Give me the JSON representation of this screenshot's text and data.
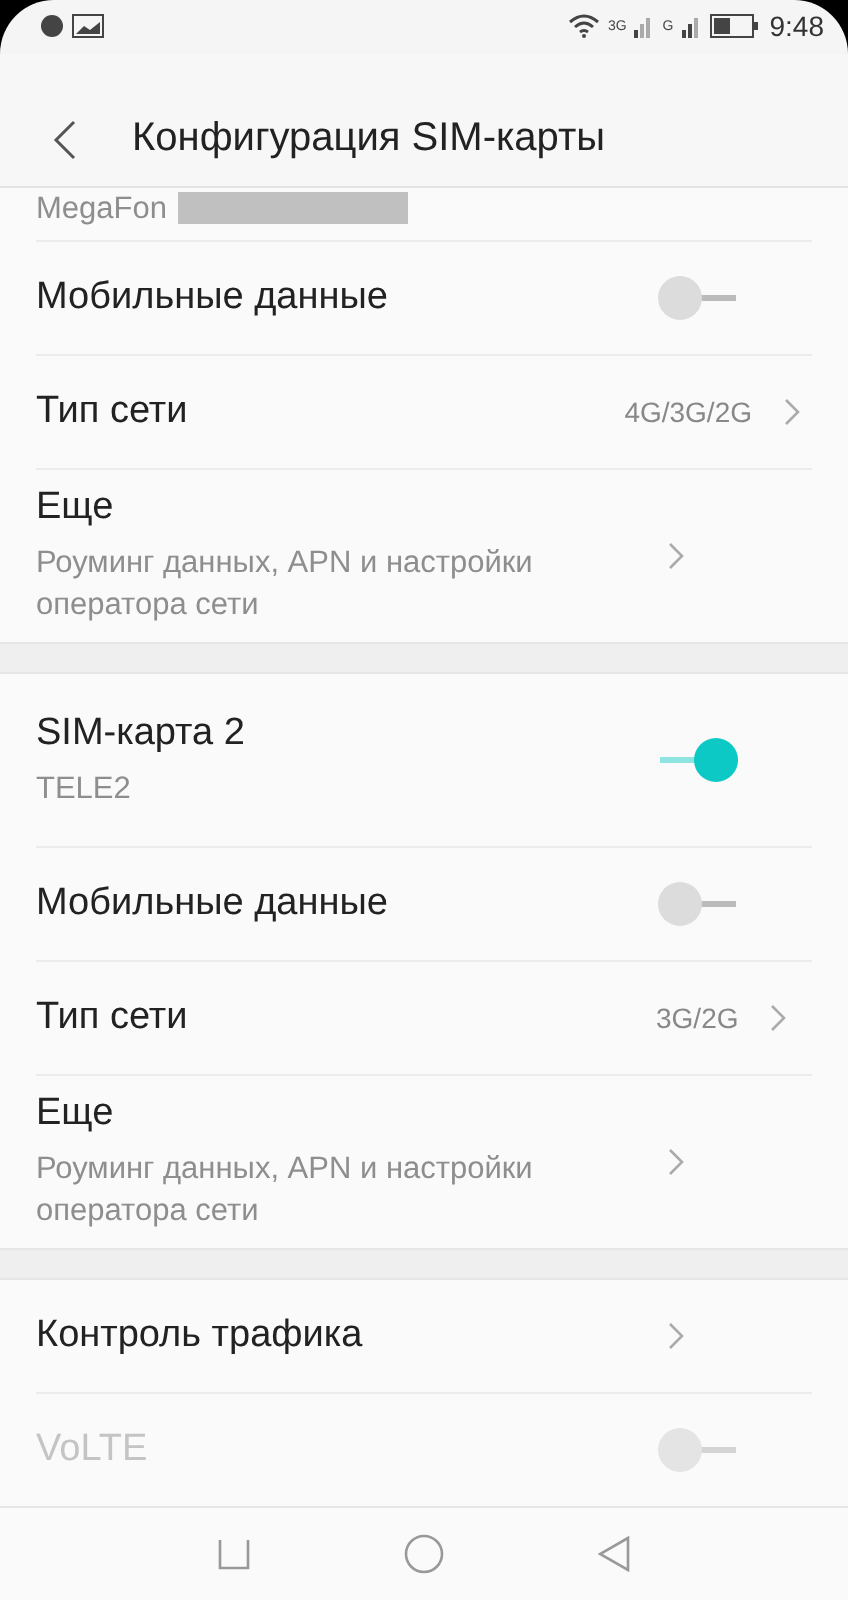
{
  "status_bar": {
    "time": "9:48",
    "network_1": "3G",
    "network_2": "G"
  },
  "header": {
    "title": "Конфигурация SIM-карты"
  },
  "sections": [
    {
      "rows": [
        {
          "kind": "carrier",
          "subtitle": "MegaFon"
        },
        {
          "kind": "toggle",
          "label": "Мобильные данные",
          "on": false,
          "disabled": false
        },
        {
          "kind": "link",
          "label": "Тип сети",
          "value": "4G/3G/2G"
        },
        {
          "kind": "link",
          "label": "Еще",
          "subtitle": "Роуминг данных, APN и настройки оператора сети"
        }
      ]
    },
    {
      "rows": [
        {
          "kind": "toggle",
          "label": "SIM-карта 2",
          "subtitle": "TELE2",
          "on": true,
          "disabled": false
        },
        {
          "kind": "toggle",
          "label": "Мобильные данные",
          "on": false,
          "disabled": false
        },
        {
          "kind": "link",
          "label": "Тип сети",
          "value": "3G/2G"
        },
        {
          "kind": "link",
          "label": "Еще",
          "subtitle": "Роуминг данных, APN и настройки оператора сети"
        }
      ]
    },
    {
      "rows": [
        {
          "kind": "link",
          "label": "Контроль трафика"
        },
        {
          "kind": "toggle",
          "label": "VoLTE",
          "on": false,
          "disabled": true
        }
      ]
    }
  ]
}
